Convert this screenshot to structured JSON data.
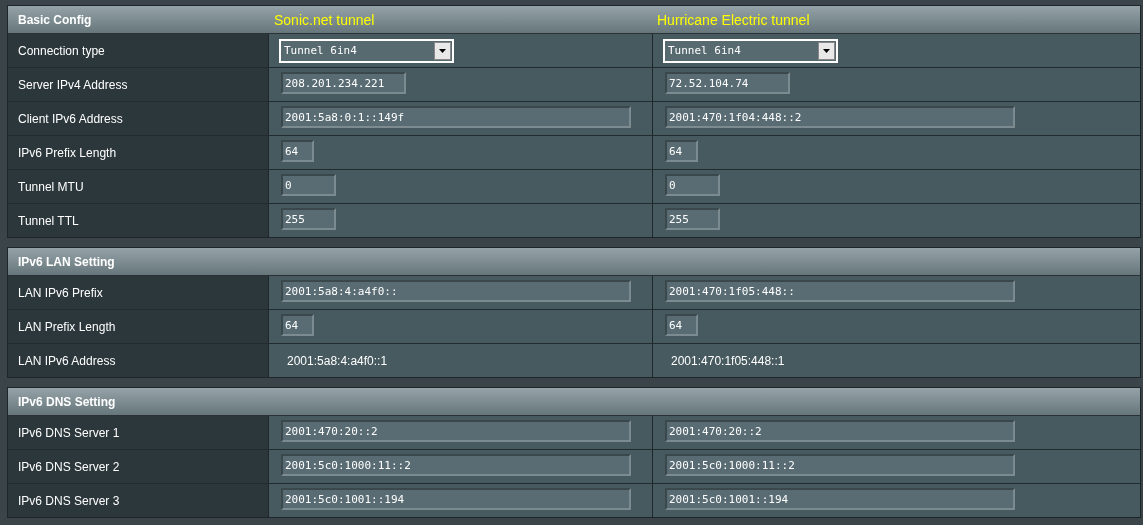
{
  "sections": [
    {
      "title": "Basic Config",
      "column_titles": [
        "Sonic.net tunnel",
        "Hurricane Electric tunnel"
      ],
      "rows": [
        {
          "label": "Connection type",
          "kind": "select",
          "values": [
            "Tunnel 6in4",
            "Tunnel 6in4"
          ]
        },
        {
          "label": "Server IPv4 Address",
          "kind": "medium",
          "values": [
            "208.201.234.221",
            "72.52.104.74"
          ]
        },
        {
          "label": "Client IPv6 Address",
          "kind": "long",
          "values": [
            "2001:5a8:0:1::149f",
            "2001:470:1f04:448::2"
          ]
        },
        {
          "label": "IPv6 Prefix Length",
          "kind": "tiny",
          "values": [
            "64",
            "64"
          ]
        },
        {
          "label": "Tunnel MTU",
          "kind": "small",
          "values": [
            "0",
            "0"
          ]
        },
        {
          "label": "Tunnel TTL",
          "kind": "small",
          "values": [
            "255",
            "255"
          ]
        }
      ]
    },
    {
      "title": "IPv6 LAN Setting",
      "rows": [
        {
          "label": "LAN IPv6 Prefix",
          "kind": "long",
          "values": [
            "2001:5a8:4:a4f0::",
            "2001:470:1f05:448::"
          ]
        },
        {
          "label": "LAN Prefix Length",
          "kind": "tiny",
          "values": [
            "64",
            "64"
          ]
        },
        {
          "label": "LAN IPv6 Address",
          "kind": "text",
          "values": [
            "2001:5a8:4:a4f0::1",
            "2001:470:1f05:448::1"
          ]
        }
      ]
    },
    {
      "title": "IPv6 DNS Setting",
      "rows": [
        {
          "label": "IPv6 DNS Server 1",
          "kind": "long",
          "values": [
            "2001:470:20::2",
            "2001:470:20::2"
          ]
        },
        {
          "label": "IPv6 DNS Server 2",
          "kind": "long",
          "values": [
            "2001:5c0:1000:11::2",
            "2001:5c0:1000:11::2"
          ]
        },
        {
          "label": "IPv6 DNS Server 3",
          "kind": "long",
          "values": [
            "2001:5c0:1001::194",
            "2001:5c0:1001::194"
          ]
        }
      ]
    }
  ]
}
